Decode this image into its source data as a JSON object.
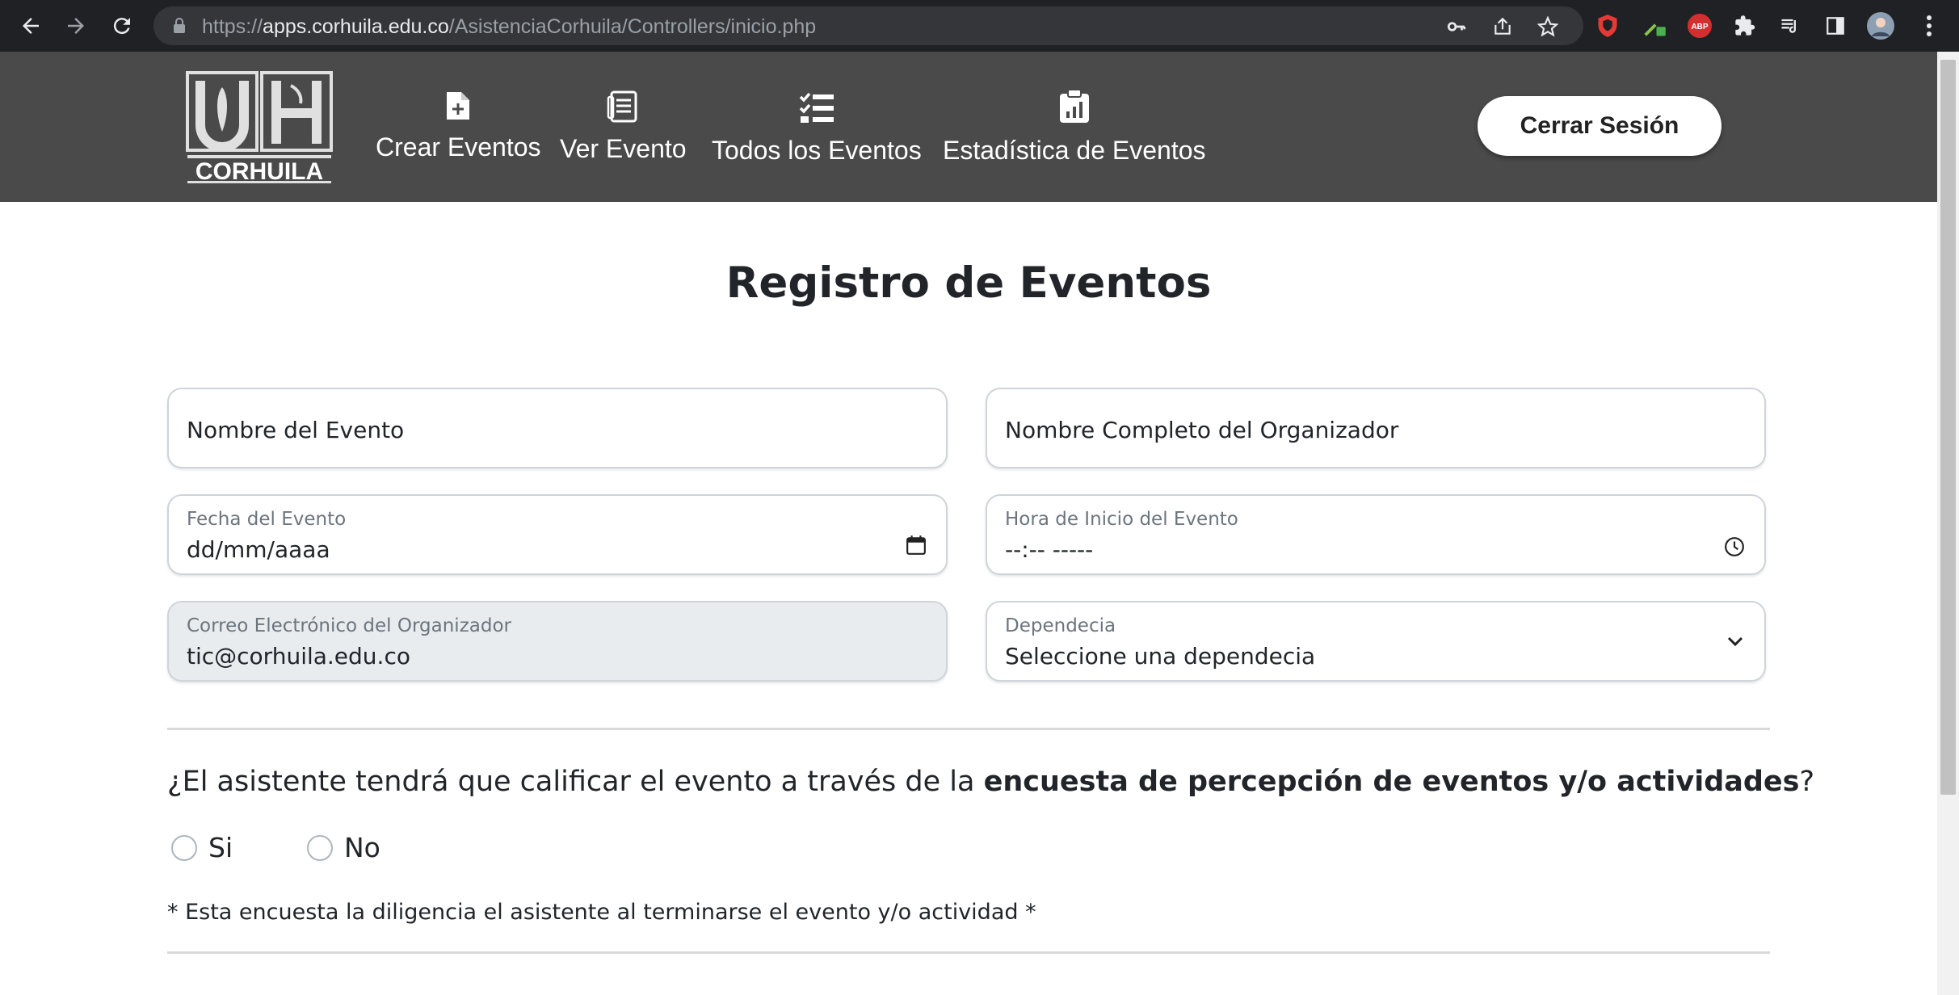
{
  "browser": {
    "url_scheme": "https://",
    "url_host": "apps.corhuila.edu.co",
    "url_path": "/AsistenciaCorhuila/Controllers/inicio.php",
    "extension_abp": "ABP"
  },
  "navbar": {
    "logo_text": "CORHUILA",
    "items": [
      {
        "label": "Crear Eventos",
        "icon": "file-plus-icon"
      },
      {
        "label": "Ver Evento",
        "icon": "document-list-icon"
      },
      {
        "label": "Todos los Eventos",
        "icon": "checklist-icon"
      },
      {
        "label": "Estadística de Eventos",
        "icon": "clipboard-chart-icon"
      }
    ],
    "logout_label": "Cerrar Sesión"
  },
  "form": {
    "title": "Registro de Eventos",
    "event_name_placeholder": "Nombre del Evento",
    "organizer_name_placeholder": "Nombre Completo del Organizador",
    "date_label": "Fecha del Evento",
    "date_value": "dd/mm/aaaa",
    "time_label": "Hora de Inicio del Evento",
    "time_value": "--:-- -----",
    "email_label": "Correo Electrónico del Organizador",
    "email_value": "tic@corhuila.edu.co",
    "dependency_label": "Dependecia",
    "dependency_value": "Seleccione una dependecia",
    "question_prefix": "¿El asistente tendrá que calificar el evento a través de la ",
    "question_bold": "encuesta de percepción de eventos y/o actividades",
    "question_suffix": "?",
    "option_yes": "Si",
    "option_no": "No",
    "note": "* Esta encuesta la diligencia el asistente al terminarse el evento y/o actividad *"
  }
}
